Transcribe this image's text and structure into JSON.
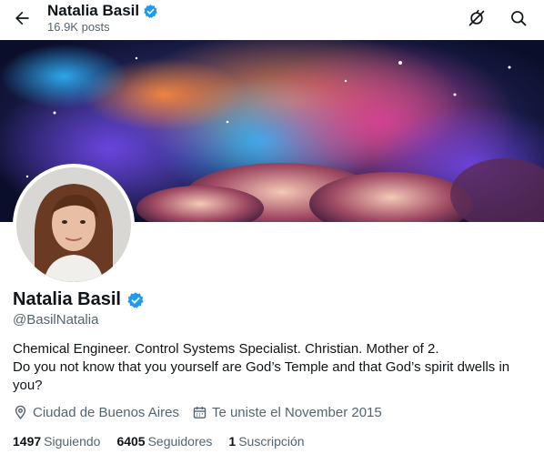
{
  "header": {
    "back_icon": "arrow-left-icon",
    "name": "Natalia Basil",
    "verified_icon": "verified-badge-icon",
    "post_count": "16.9K posts",
    "actions": [
      {
        "icon": "media-off-icon"
      },
      {
        "icon": "search-icon"
      }
    ]
  },
  "profile": {
    "name": "Natalia Basil",
    "handle": "@BasilNatalia",
    "bio_lines": [
      "Chemical Engineer. Control Systems Specialist. Christian. Mother of 2.",
      "Do you not know that you yourself are God’s Temple and that God’s spirit dwells in",
      "you?"
    ],
    "location": "Ciudad de Buenos Aires",
    "joined": "Te uniste el November 2015",
    "stats": {
      "following_count": "1497",
      "following_label": "Siguiendo",
      "followers_count": "6405",
      "followers_label": "Seguidores",
      "subscriptions_count": "1",
      "subscriptions_label": "Suscripción"
    }
  },
  "colors": {
    "verified": "#1d9bf0",
    "text_primary": "#0f1419",
    "text_secondary": "#536471"
  }
}
